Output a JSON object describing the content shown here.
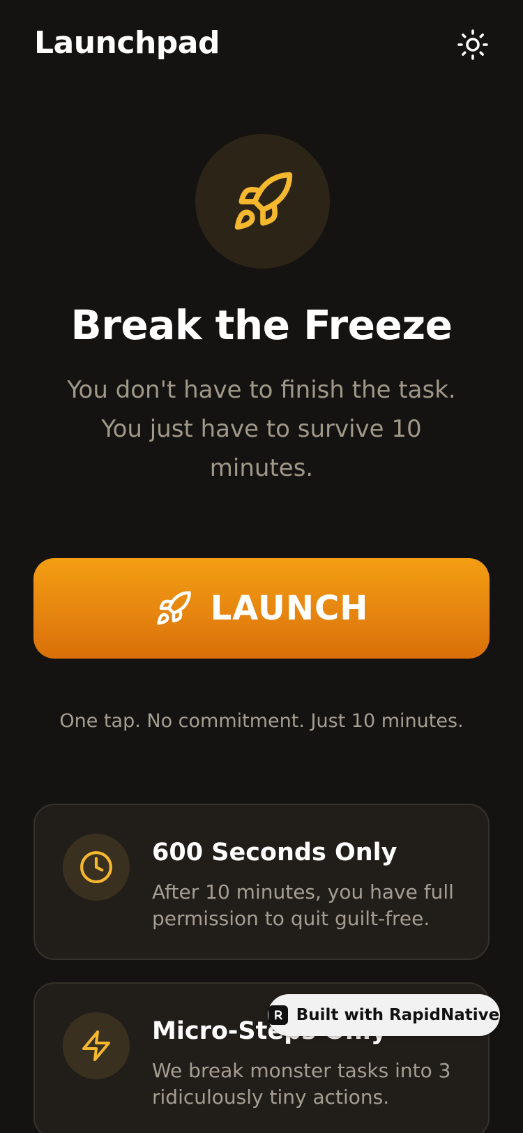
{
  "header": {
    "title": "Launchpad",
    "theme_icon": "sun-icon"
  },
  "hero": {
    "icon": "rocket-icon",
    "title": "Break the Freeze",
    "subtitle": "You don't have to finish the task. You just have to survive 10 minutes."
  },
  "launch_button": {
    "icon": "rocket-icon",
    "label": "LAUNCH"
  },
  "tagline": "One tap. No commitment. Just 10 minutes.",
  "features": [
    {
      "icon": "clock-icon",
      "title": "600 Seconds Only",
      "description": "After 10 minutes, you have full permission to quit guilt-free."
    },
    {
      "icon": "lightning-icon",
      "title": "Micro-Steps Only",
      "description": "We break monster tasks into 3 ridiculously tiny actions."
    }
  ],
  "badge": {
    "label": "Built with RapidNative"
  },
  "colors": {
    "background": "#151311",
    "accent": "#f5b82e",
    "button_top": "#f39e12",
    "button_bottom": "#d96f08",
    "card_background": "#211e1a",
    "muted_text": "#a69e92"
  }
}
